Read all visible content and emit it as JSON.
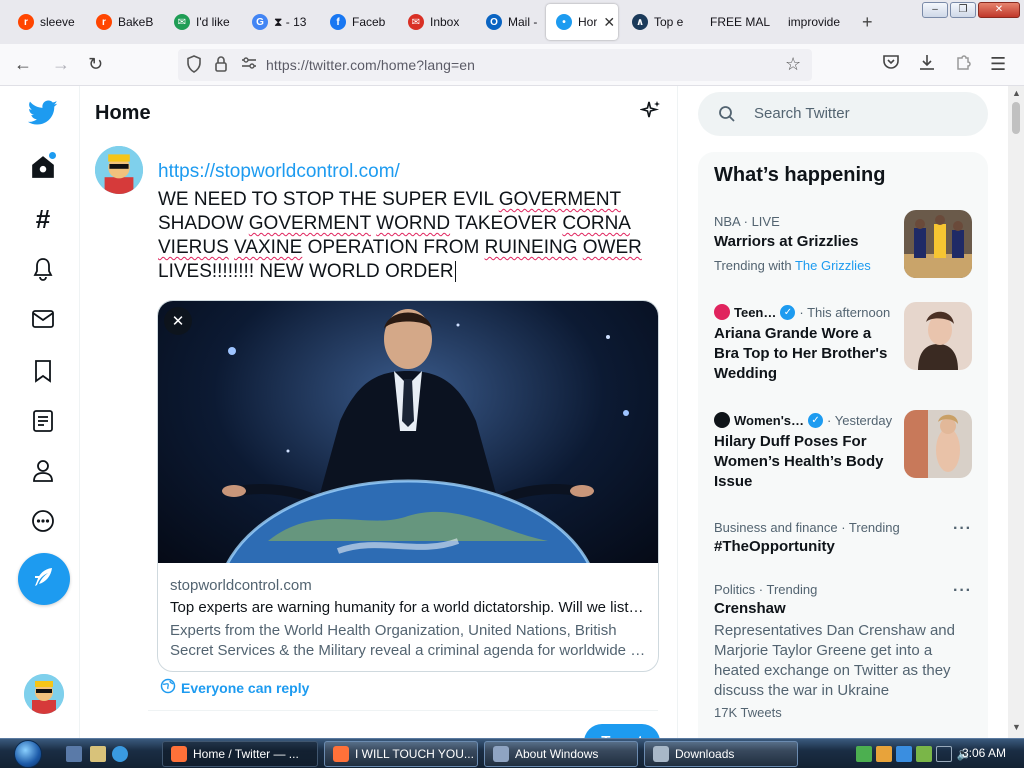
{
  "browser": {
    "tabs": [
      {
        "title": "sleeve",
        "icon": "reddit-icon",
        "color": "#ff4500",
        "glyph": "r"
      },
      {
        "title": "BakeB",
        "icon": "reddit-icon",
        "color": "#ff4500",
        "glyph": "r"
      },
      {
        "title": "I'd like",
        "icon": "chat-icon",
        "color": "#1f9d55",
        "glyph": "✉"
      },
      {
        "title": "⧗ - 13",
        "icon": "google-icon",
        "color": "#4285f4",
        "glyph": "G"
      },
      {
        "title": "Faceb",
        "icon": "facebook-icon",
        "color": "#1877f2",
        "glyph": "f"
      },
      {
        "title": "Inbox",
        "icon": "mail-icon",
        "color": "#d93025",
        "glyph": "✉"
      },
      {
        "title": "Mail -",
        "icon": "outlook-icon",
        "color": "#0a64c2",
        "glyph": "O"
      },
      {
        "title": "Hor",
        "icon": "twitter-icon",
        "color": "#1d9bf0",
        "glyph": "•",
        "active": true
      },
      {
        "title": "Top e",
        "icon": "bird-icon",
        "color": "#1b3a5a",
        "glyph": "∧"
      },
      {
        "title": "FREE MAL",
        "icon": "",
        "color": "",
        "glyph": ""
      },
      {
        "title": "improvide",
        "icon": "",
        "color": "",
        "glyph": ""
      }
    ],
    "new_tab": "+",
    "tab_close": "✕",
    "url": "https://twitter.com/home?lang=en"
  },
  "twitter": {
    "page_title": "Home",
    "nav": [
      "home-icon",
      "explore-icon",
      "notifications-icon",
      "messages-icon",
      "bookmarks-icon",
      "lists-icon",
      "profile-icon",
      "more-icon"
    ],
    "compose_icon": "feather-icon",
    "tweet": {
      "link": "https://stopworldcontrol.com/",
      "segments": [
        {
          "t": "WE NEED TO STOP THE SUPER EVIL ",
          "s": false
        },
        {
          "t": "GOVERMENT",
          "s": true
        },
        {
          "t": " SHADOW ",
          "s": false
        },
        {
          "t": "GOVERMENT",
          "s": true
        },
        {
          "t": " ",
          "s": false
        },
        {
          "t": "WORND",
          "s": true
        },
        {
          "t": " TAKEOVER ",
          "s": false
        },
        {
          "t": "CORNA",
          "s": true
        },
        {
          "t": " ",
          "s": false
        },
        {
          "t": "VIERUS",
          "s": true
        },
        {
          "t": " ",
          "s": false
        },
        {
          "t": "VAXINE",
          "s": true
        },
        {
          "t": " OPERATION FROM ",
          "s": false
        },
        {
          "t": "RUINEING",
          "s": true
        },
        {
          "t": " ",
          "s": false
        },
        {
          "t": "OWER",
          "s": true
        },
        {
          "t": " LIVES!!!!!!!! NEW WORLD ORDER",
          "s": false
        }
      ],
      "card": {
        "domain": "stopworldcontrol.com",
        "title": "Top experts are warning humanity for a world dictatorship. Will we list…",
        "description": "Experts from the World Health Organization, United Nations, British Secret Services & the Military reveal a criminal agenda for worldwide …",
        "close": "✕"
      },
      "reply_setting": "Everyone can reply",
      "tweet_button": "Tweet"
    },
    "search_placeholder": "Search Twitter",
    "happening": {
      "title": "What’s happening",
      "trends": [
        {
          "meta": "NBA · LIVE",
          "title": "Warriors at Grizzlies",
          "sub_prefix": "Trending with",
          "sub_link": "The Grizzlies",
          "thumb_colors": [
            "#1f2a66",
            "#f6c532",
            "#ffffff"
          ]
        },
        {
          "source": "Teen…",
          "time": "· This afternoon",
          "title": "Ariana Grande Wore a Bra Top to Her Brother's Wedding",
          "source_color": "#e0245e",
          "thumb_colors": [
            "#d9c4b8",
            "#3a2a22",
            "#f3e6de"
          ]
        },
        {
          "source": "Women's…",
          "time": "· Yesterday",
          "title": "Hilary Duff Poses For Women’s Health’s Body Issue",
          "source_color": "#0f1419",
          "thumb_colors": [
            "#c8795a",
            "#e9c2a8",
            "#d8d0c8"
          ]
        },
        {
          "meta": "Business and finance · Trending",
          "title": "#TheOpportunity"
        },
        {
          "meta": "Politics · Trending",
          "title": "Crenshaw",
          "desc": "Representatives Dan Crenshaw and Marjorie Taylor Greene get into a heated exchange on Twitter as they discuss the war in Ukraine",
          "count": "17K Tweets"
        }
      ],
      "more": "···"
    }
  },
  "taskbar": {
    "buttons": [
      {
        "label": "Home / Twitter — ...",
        "color": "#ff7139",
        "active": true
      },
      {
        "label": "I WILL TOUCH YOU...",
        "color": "#ff7139"
      },
      {
        "label": "About Windows",
        "color": "#8fa4c2"
      },
      {
        "label": "Downloads",
        "color": "#a8b8c8"
      }
    ],
    "clock": "3:06 AM"
  },
  "colors": {
    "twitter_blue": "#1d9bf0",
    "text": "#0f1419",
    "muted": "#536471"
  }
}
